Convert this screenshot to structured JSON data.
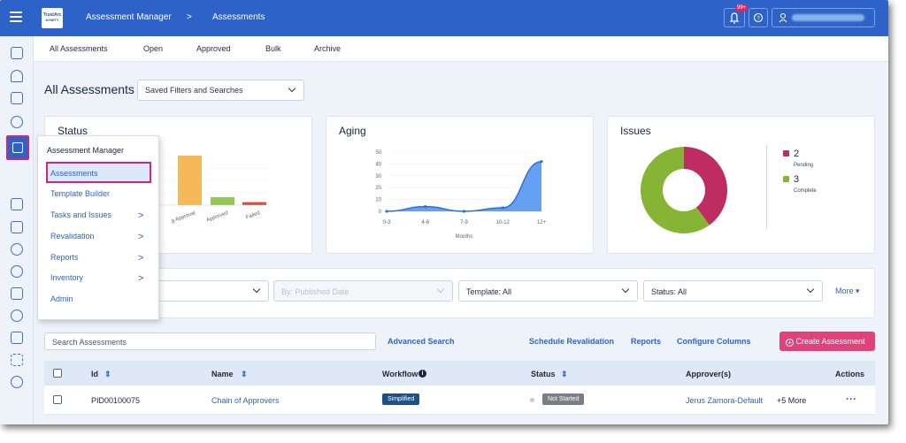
{
  "header": {
    "logo_line1": "TrustArc",
    "logo_line2": "NYMITY",
    "breadcrumb": [
      "Assessment Manager",
      "Assessments"
    ],
    "breadcrumb_sep": ">",
    "notification_badge": "99+",
    "help_icon": "question-circle-icon",
    "user_icon": "user-icon"
  },
  "tabs": [
    "All Assessments",
    "Open",
    "Approved",
    "Bulk",
    "Archive"
  ],
  "page": {
    "title": "All Assessments",
    "saved_filters": "Saved Filters and Searches"
  },
  "cards": {
    "status_title": "Status",
    "aging_title": "Aging",
    "issues_title": "Issues"
  },
  "chart_data": [
    {
      "type": "bar",
      "title": "Status",
      "categories": [
        "In Progress",
        "Pending Approval",
        "Approved",
        "Failed"
      ],
      "visible_category_labels": [
        "s",
        "g Approval",
        "Approved",
        "Failed"
      ],
      "values": [
        5,
        5,
        0.8,
        0.3
      ],
      "colors": [
        "#e06b3f",
        "#f5b95a",
        "#92c955",
        "#dd4c3d"
      ]
    },
    {
      "type": "area",
      "title": "Aging",
      "categories": [
        "0-3",
        "4-6",
        "7-9",
        "10-12",
        "12+"
      ],
      "values": [
        0,
        4,
        0,
        3,
        42
      ],
      "y_ticks": [
        0,
        10,
        20,
        30,
        40,
        50
      ],
      "ylim": [
        0,
        50
      ],
      "xlabel": "Months",
      "color": "#4a8ff0"
    },
    {
      "type": "pie",
      "title": "Issues",
      "donut": true,
      "series": [
        {
          "name": "Pending",
          "value": 2,
          "color": "#be2c62"
        },
        {
          "name": "Complete",
          "value": 3,
          "color": "#86b535"
        }
      ]
    }
  ],
  "filters": {
    "published_date": "By: Published Date",
    "template": "Template: All",
    "status": "Status: All",
    "more": "More ▾"
  },
  "actions": {
    "search_placeholder": "Search Assessments",
    "advanced_search": "Advanced Search",
    "schedule_revalidation": "Schedule Revalidation",
    "reports": "Reports",
    "configure_columns": "Configure Columns",
    "create": "Create Assessment"
  },
  "table": {
    "columns": [
      "Id",
      "Name",
      "Workflow",
      "Status",
      "Approver(s)",
      "Actions"
    ],
    "rows": [
      {
        "id": "PID00100075",
        "name": "Chain of Approvers",
        "workflow": "Simplified",
        "status": "Not Started",
        "approver": "Jerus Zamora-Default",
        "approver_more": "+5 More",
        "actions": "···"
      }
    ]
  },
  "flyout": {
    "heading": "Assessment Manager",
    "items": [
      {
        "label": "Assessments",
        "submenu": false
      },
      {
        "label": "Template Builder",
        "submenu": false
      },
      {
        "label": "Tasks and Issues",
        "submenu": true
      },
      {
        "label": "Revalidation",
        "submenu": true
      },
      {
        "label": "Reports",
        "submenu": true
      },
      {
        "label": "Inventory",
        "submenu": true
      },
      {
        "label": "Admin",
        "submenu": false
      }
    ],
    "arrow": ">"
  },
  "colors": {
    "brand": "#2d63c8",
    "accent": "#e0427a",
    "highlight": "#d0277b"
  }
}
